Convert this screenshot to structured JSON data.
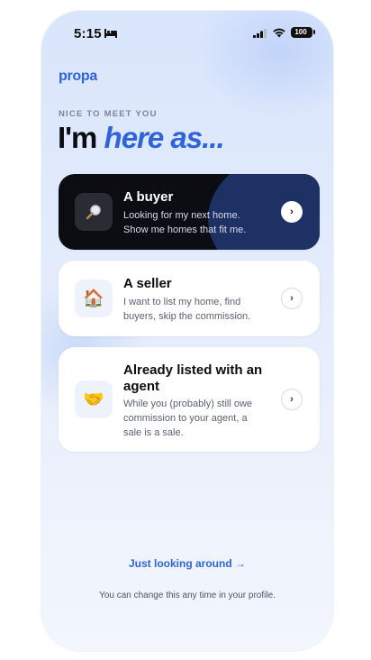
{
  "status_bar": {
    "time": "5:15",
    "battery": "100"
  },
  "brand": {
    "logo": "propa",
    "accent_color": "#2f64d8"
  },
  "intro": {
    "eyebrow": "NICE TO MEET YOU",
    "headline_prefix": "I'm",
    "headline_accent": "here as..."
  },
  "options": [
    {
      "title": "A buyer",
      "description": "Looking for my next home. Show me homes that fit me.",
      "icon": "magnifier-icon",
      "selected": true
    },
    {
      "title": "A seller",
      "description": "I want to list my home, find buyers, skip the commission.",
      "icon": "house-icon",
      "selected": false
    },
    {
      "title": "Already listed with an agent",
      "description": "While you (probably) still owe commission to your agent, a sale is a sale.",
      "icon": "handshake-icon",
      "selected": false
    }
  ],
  "footer": {
    "link": "Just looking around →",
    "note": "You can change this any time in your profile."
  }
}
